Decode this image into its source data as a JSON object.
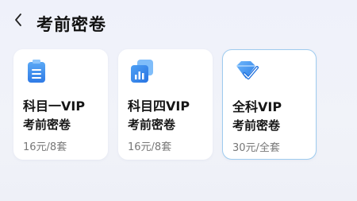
{
  "header": {
    "back_icon": "chevron-left-icon",
    "title": "考前密卷"
  },
  "cards": [
    {
      "name": "科目一VIP",
      "subtitle": "考前密卷",
      "price": "16元/8套",
      "icon": "clipboard-icon",
      "selected": false
    },
    {
      "name": "科目四VIP",
      "subtitle": "考前密卷",
      "price": "16元/8套",
      "icon": "chart-stack-icon",
      "selected": false
    },
    {
      "name": "全科VIP",
      "subtitle": "考前密卷",
      "price": "30元/全套",
      "icon": "diamond-check-icon",
      "selected": true
    }
  ],
  "colors": {
    "accent_blue": "#2b7ce9",
    "selected_border": "#9ecbef",
    "background": "#eff1fa"
  }
}
